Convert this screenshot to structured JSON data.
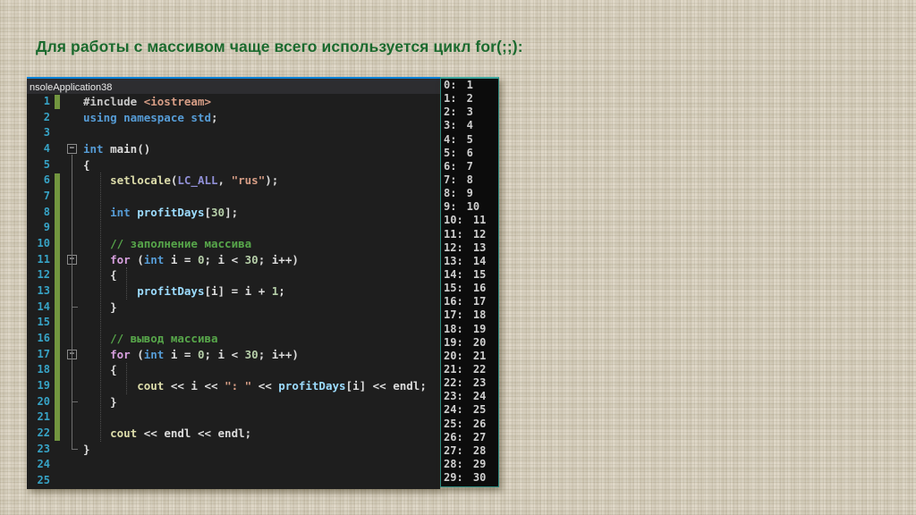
{
  "slide": {
    "title": "Для работы с массивом чаще всего используется цикл for(;;):",
    "title_color": "#1B6A2E",
    "background_color": "#D8D0BD"
  },
  "palette": {
    "kw": "#569CD6",
    "ctl": "#D8A0DF",
    "str": "#D69D85",
    "com": "#57A64A",
    "num": "#B5CEA8",
    "id": "#9CDCFE",
    "fn": "#DCDCAA",
    "txt": "#DCDCDC",
    "pre": "#C8C8C8",
    "mac": "#908FD6"
  },
  "editor": {
    "tab_label": "nsoleApplication38",
    "accent_color": "#0C83D8",
    "line_number_color": "#37A3C6",
    "change_bar_color": "#72963F",
    "fold_glyph": "−",
    "change_bars": [
      [
        1,
        1
      ],
      [
        6,
        22
      ]
    ],
    "fold_markers": [
      4,
      11,
      17
    ],
    "lines": [
      {
        "n": 1,
        "tokens": [
          [
            "#include ",
            "pre"
          ],
          [
            "<iostream>",
            "str"
          ]
        ]
      },
      {
        "n": 2,
        "tokens": [
          [
            "using namespace std",
            "kw"
          ],
          [
            ";",
            "txt"
          ]
        ]
      },
      {
        "n": 3,
        "tokens": []
      },
      {
        "n": 4,
        "tokens": [
          [
            "int",
            "kw"
          ],
          [
            " main()",
            "txt"
          ]
        ]
      },
      {
        "n": 5,
        "tokens": [
          [
            "{",
            "txt"
          ]
        ]
      },
      {
        "n": 6,
        "tokens": [
          [
            "    ",
            "txt"
          ],
          [
            "setlocale",
            "fn"
          ],
          [
            "(",
            "txt"
          ],
          [
            "LC_ALL",
            "mac"
          ],
          [
            ", ",
            "txt"
          ],
          [
            "\"rus\"",
            "str"
          ],
          [
            ");",
            "txt"
          ]
        ]
      },
      {
        "n": 7,
        "tokens": []
      },
      {
        "n": 8,
        "tokens": [
          [
            "    ",
            "txt"
          ],
          [
            "int",
            "kw"
          ],
          [
            " ",
            "txt"
          ],
          [
            "profitDays",
            "id"
          ],
          [
            "[",
            "txt"
          ],
          [
            "30",
            "num"
          ],
          [
            "];",
            "txt"
          ]
        ]
      },
      {
        "n": 9,
        "tokens": []
      },
      {
        "n": 10,
        "tokens": [
          [
            "    ",
            "txt"
          ],
          [
            "// заполнение массива",
            "com"
          ]
        ]
      },
      {
        "n": 11,
        "tokens": [
          [
            "    ",
            "txt"
          ],
          [
            "for",
            "ctl"
          ],
          [
            " (",
            "txt"
          ],
          [
            "int",
            "kw"
          ],
          [
            " i = ",
            "txt"
          ],
          [
            "0",
            "num"
          ],
          [
            "; i < ",
            "txt"
          ],
          [
            "30",
            "num"
          ],
          [
            "; i++)",
            "txt"
          ]
        ]
      },
      {
        "n": 12,
        "tokens": [
          [
            "    {",
            "txt"
          ]
        ]
      },
      {
        "n": 13,
        "tokens": [
          [
            "        ",
            "txt"
          ],
          [
            "profitDays",
            "id"
          ],
          [
            "[i] = i + ",
            "txt"
          ],
          [
            "1",
            "num"
          ],
          [
            ";",
            "txt"
          ]
        ]
      },
      {
        "n": 14,
        "tokens": [
          [
            "    }",
            "txt"
          ]
        ]
      },
      {
        "n": 15,
        "tokens": []
      },
      {
        "n": 16,
        "tokens": [
          [
            "    ",
            "txt"
          ],
          [
            "// вывод массива",
            "com"
          ]
        ]
      },
      {
        "n": 17,
        "tokens": [
          [
            "    ",
            "txt"
          ],
          [
            "for",
            "ctl"
          ],
          [
            " (",
            "txt"
          ],
          [
            "int",
            "kw"
          ],
          [
            " i = ",
            "txt"
          ],
          [
            "0",
            "num"
          ],
          [
            "; i < ",
            "txt"
          ],
          [
            "30",
            "num"
          ],
          [
            "; i++)",
            "txt"
          ]
        ]
      },
      {
        "n": 18,
        "tokens": [
          [
            "    {",
            "txt"
          ]
        ]
      },
      {
        "n": 19,
        "tokens": [
          [
            "        ",
            "txt"
          ],
          [
            "cout",
            "fn"
          ],
          [
            " << i << ",
            "txt"
          ],
          [
            "\": \"",
            "str"
          ],
          [
            " << ",
            "txt"
          ],
          [
            "profitDays",
            "id"
          ],
          [
            "[i] << endl;",
            "txt"
          ]
        ]
      },
      {
        "n": 20,
        "tokens": [
          [
            "    }",
            "txt"
          ]
        ]
      },
      {
        "n": 21,
        "tokens": []
      },
      {
        "n": 22,
        "tokens": [
          [
            "    ",
            "txt"
          ],
          [
            "cout",
            "fn"
          ],
          [
            " << endl << endl;",
            "txt"
          ]
        ]
      },
      {
        "n": 23,
        "tokens": [
          [
            "}",
            "txt"
          ]
        ]
      },
      {
        "n": 24,
        "tokens": []
      },
      {
        "n": 25,
        "tokens": []
      }
    ]
  },
  "console": {
    "border_color": "#2E8B80",
    "border_top_color": "#3EA79E",
    "background_color": "#0C0C0C",
    "text_color": "#CFCFCF",
    "lines": [
      "0: 1",
      "1: 2",
      "2: 3",
      "3: 4",
      "4: 5",
      "5: 6",
      "6: 7",
      "7: 8",
      "8: 9",
      "9: 10",
      "10: 11",
      "11: 12",
      "12: 13",
      "13: 14",
      "14: 15",
      "15: 16",
      "16: 17",
      "17: 18",
      "18: 19",
      "19: 20",
      "20: 21",
      "21: 22",
      "22: 23",
      "23: 24",
      "24: 25",
      "25: 26",
      "26: 27",
      "27: 28",
      "28: 29",
      "29: 30"
    ]
  }
}
